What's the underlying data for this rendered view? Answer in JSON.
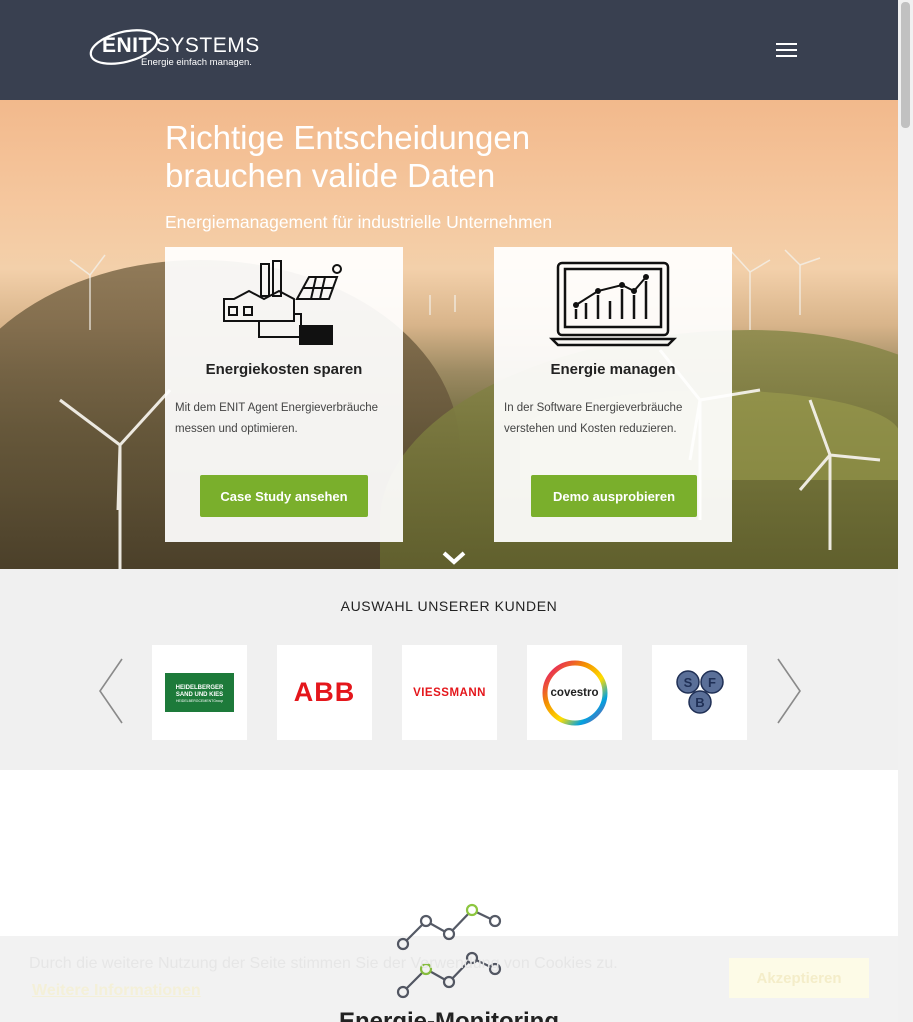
{
  "header": {
    "logo_brand": "ENIT",
    "logo_brand2": "SYSTEMS",
    "logo_tagline": "Energie einfach managen.",
    "menu_icon": "hamburger-menu-icon"
  },
  "hero": {
    "title_line1": "Richtige Entscheidungen",
    "title_line2": "brauchen valide Daten",
    "subtitle": "Energiemanagement für industrielle Unternehmen",
    "cards": [
      {
        "title": "Energiekosten sparen",
        "text": "Mit dem ENIT Agent Energieverbräuche messen und optimieren.",
        "button": "Case Study ansehen",
        "icon": "factory-solar-icon"
      },
      {
        "title": "Energie managen",
        "text": "In der Software Energieverbräuche verstehen und Kosten reduzieren.",
        "button": "Demo ausprobieren",
        "icon": "laptop-chart-icon"
      }
    ],
    "scroll_icon": "chevron-down-icon"
  },
  "customers": {
    "title": "AUSWAHL UNSERER KUNDEN",
    "logos": [
      {
        "name": "heidelberger",
        "line1": "HEIDELBERGER",
        "line2": "SAND UND KIES",
        "line3": "HEIDELBERGCEMENTGroup"
      },
      {
        "name": "abb",
        "text": "ABB"
      },
      {
        "name": "viessmann",
        "text": "VIESSMANN"
      },
      {
        "name": "covestro",
        "text": "covestro"
      },
      {
        "name": "sfb",
        "letters": [
          "S",
          "F",
          "B"
        ]
      }
    ]
  },
  "section": {
    "title": "Energie-Monitoring"
  },
  "cookie": {
    "message": "Durch die weitere Nutzung der Seite stimmen Sie der Verwendung von Cookies zu.",
    "more_link": "Weitere Informationen",
    "accept_button": "Akzeptieren"
  },
  "colors": {
    "header_bg": "#394050",
    "button_green": "#7aaf2c",
    "accent_green": "#8cc63f"
  }
}
